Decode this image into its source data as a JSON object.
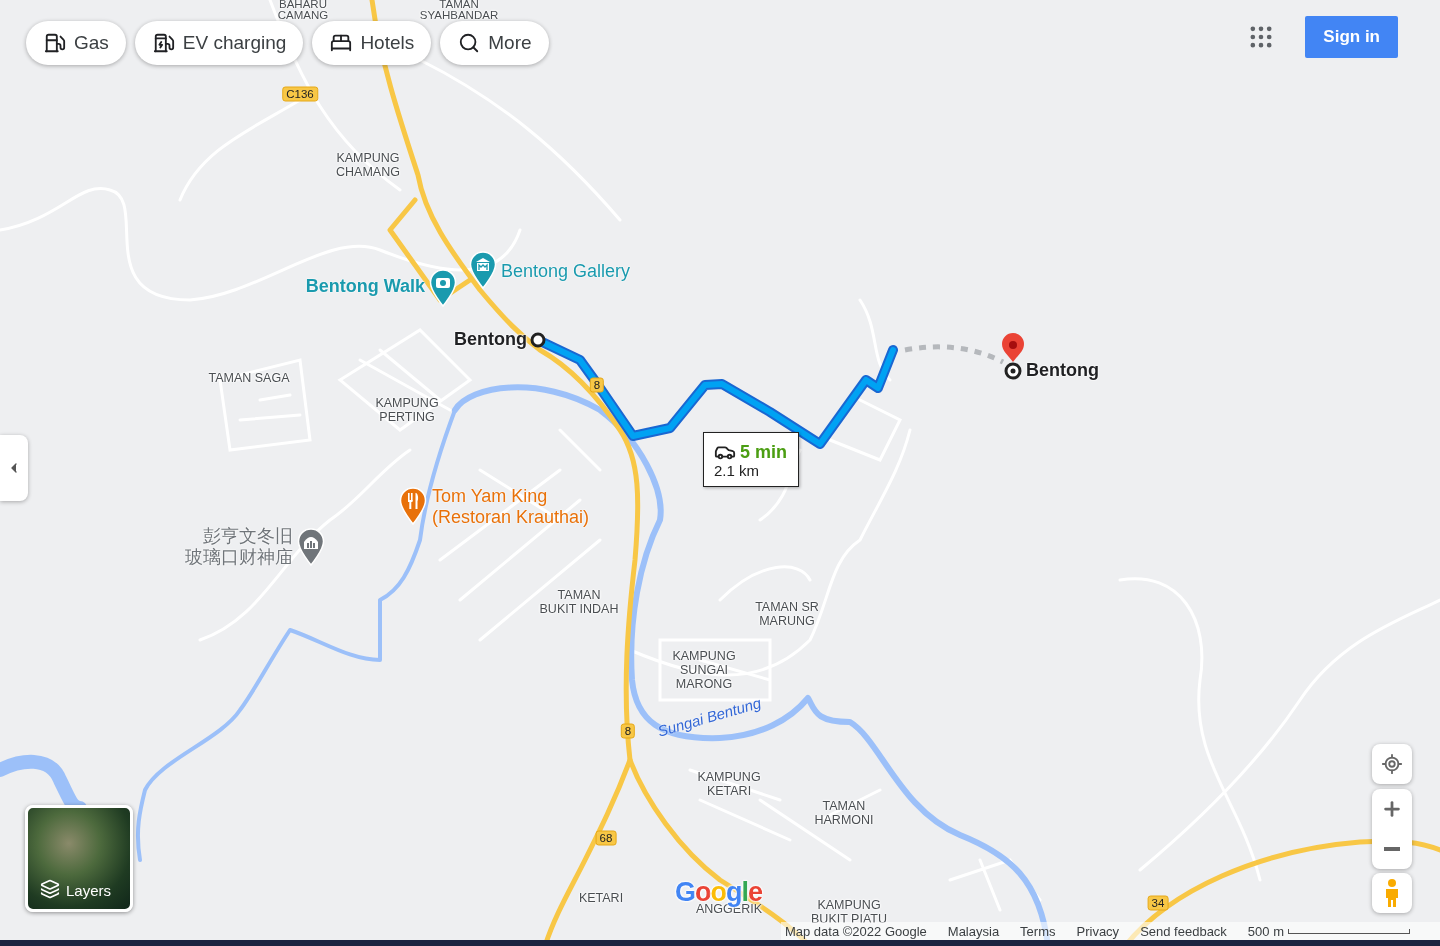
{
  "filter_chips": [
    {
      "label": "Gas"
    },
    {
      "label": "EV charging"
    },
    {
      "label": "Hotels"
    },
    {
      "label": "More"
    }
  ],
  "sign_in": "Sign in",
  "map": {
    "area_labels": [
      {
        "lines": [
          "BAHARU",
          "CAMANG"
        ]
      },
      {
        "lines": [
          "TAMAN",
          "SYAHBANDAR"
        ]
      },
      {
        "lines": [
          "KAMPUNG",
          "CHAMANG"
        ]
      },
      {
        "lines": [
          "TAMAN SAGA"
        ]
      },
      {
        "lines": [
          "KAMPUNG",
          "PERTING"
        ]
      },
      {
        "lines": [
          "TAMAN",
          "BUKIT INDAH"
        ]
      },
      {
        "lines": [
          "TAMAN SR",
          "MARUNG"
        ]
      },
      {
        "lines": [
          "KAMPUNG",
          "SUNGAI",
          "MARONG"
        ]
      },
      {
        "lines": [
          "KAMPUNG",
          "KETARI"
        ]
      },
      {
        "lines": [
          "TAMAN",
          "HARMONI"
        ]
      },
      {
        "lines": [
          "KETARI"
        ]
      },
      {
        "lines": [
          "ANGGERIK"
        ]
      },
      {
        "lines": [
          "KAMPUNG",
          "BUKIT PIATU"
        ]
      }
    ],
    "places": [
      {
        "lines": [
          "Bentong Walk"
        ],
        "color": "#1a9aae"
      },
      {
        "lines": [
          "Bentong Gallery"
        ],
        "color": "#1a9aae"
      },
      {
        "lines": [
          "Tom Yam King",
          "(Restoran Krauthai)"
        ],
        "color": "#e8710a"
      },
      {
        "lines": [
          "彭亨文冬旧",
          "玻璃口财神庙"
        ],
        "color": "#70757a"
      }
    ],
    "road_shields": [
      "C136",
      "8",
      "8",
      "68",
      "34"
    ],
    "river_label": "Sungai Bentung",
    "route": {
      "origin": "Bentong",
      "destination": "Bentong",
      "duration": "5 min",
      "distance": "2.1 km"
    }
  },
  "layers": "Layers",
  "logo": "Google",
  "footer": [
    "Map data ©2022 Google",
    "Malaysia",
    "Terms",
    "Privacy",
    "Send feedback"
  ],
  "scale": "500 m"
}
